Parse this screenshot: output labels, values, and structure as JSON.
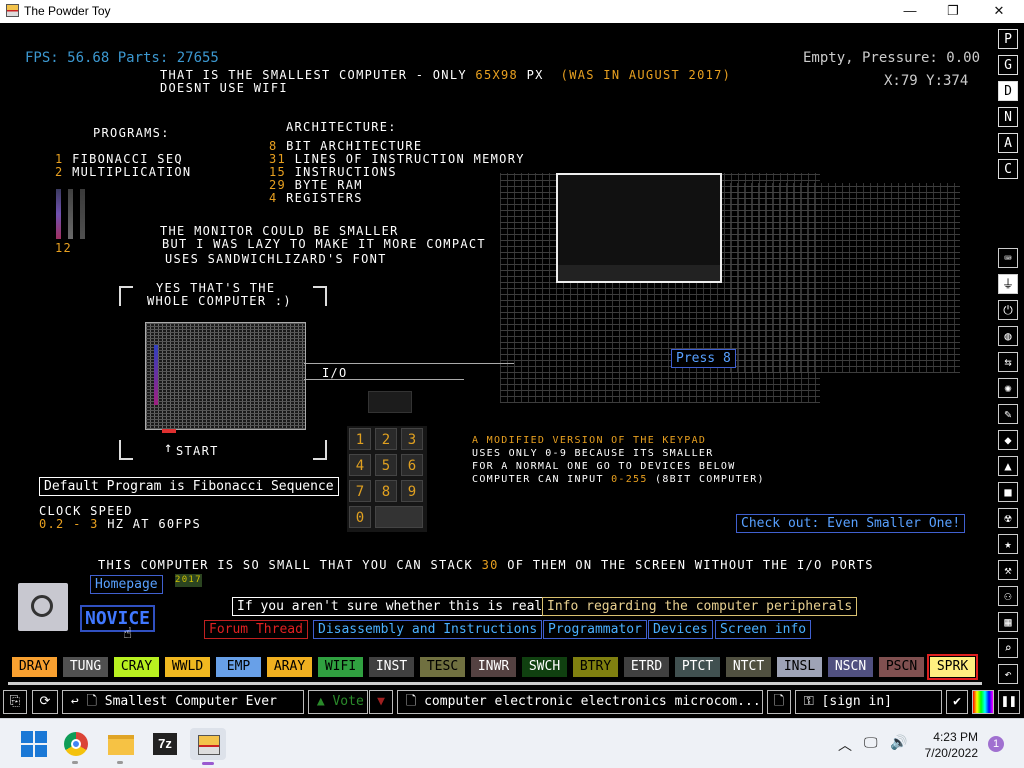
{
  "window": {
    "title": "The Powder Toy",
    "minimize": "—",
    "maximize": "❐",
    "close": "✕"
  },
  "hud": {
    "fps": "FPS: 56.68 Parts: 27655",
    "pressure": "Empty, Pressure: 0.00",
    "coords": "X:79 Y:374"
  },
  "save_text": {
    "line1a": "THAT IS THE SMALLEST COMPUTER - ONLY ",
    "line1b": "65X98",
    "line1c": " PX  ",
    "line1d": "(WAS IN AUGUST 2017)",
    "line2": "DOESNT USE WIFI",
    "programs_title": "PROGRAMS:",
    "program1_num": "1",
    "program1": "FIBONACCI SEQ",
    "program2_num": "2",
    "program2": "MULTIPLICATION",
    "bar_labels": "12",
    "arch_title": "ARCHITECTURE:",
    "arch": [
      {
        "num": "8",
        "text": "BIT ARCHITECTURE"
      },
      {
        "num": "31",
        "text": "LINES OF INSTRUCTION MEMORY"
      },
      {
        "num": "15",
        "text": "INSTRUCTIONS"
      },
      {
        "num": "29",
        "text": "BYTE RAM"
      },
      {
        "num": "4",
        "text": "REGISTERS"
      }
    ],
    "monitor1": "THE MONITOR COULD BE SMALLER",
    "monitor2": "BUT I WAS LAZY TO MAKE IT MORE COMPACT",
    "monitor3": "USES SANDWICHLIZARD'S FONT",
    "whole1": "YES THAT'S THE",
    "whole2": "WHOLE COMPUTER :)",
    "io": "I/O",
    "start": "START",
    "keypad1": "A MODIFIED VERSION OF THE KEYPAD",
    "keypad2": "USES ONLY 0-9 BECAUSE ITS SMALLER",
    "keypad3": "FOR A NORMAL ONE GO TO DEVICES BELOW",
    "keypad4a": "COMPUTER CAN INPUT ",
    "keypad4b": "0-255",
    "keypad4c": " (8BIT COMPUTER)",
    "clock1": "CLOCK SPEED",
    "clock2a": "0.2 - 3",
    "clock2b": " HZ AT 60FPS",
    "stack_a": "THIS COMPUTER IS SO SMALL THAT YOU CAN STACK ",
    "stack_b": "30",
    "stack_c": " OF THEM ON THE SCREEN WITHOUT THE I/O PORTS",
    "year": "2017"
  },
  "keypad_keys": [
    "1",
    "2",
    "3",
    "4",
    "5",
    "6",
    "7",
    "8",
    "9",
    "0"
  ],
  "labels": {
    "default_program": "Default Program is Fibonacci Sequence",
    "press8": "Press 8",
    "check_out": "Check out: Even Smaller One!",
    "homepage": "Homepage",
    "novice": "NOVICE",
    "if_unsure": "If you aren't sure whether this is real:",
    "info_peripherals": "Info regarding the computer peripherals",
    "forum_thread": "Forum Thread",
    "disassembly": "Disassembly and Instructions",
    "programmator": "Programmator",
    "devices": "Devices",
    "screen_info": "Screen info"
  },
  "right_toolbar_letters": [
    "P",
    "G",
    "D",
    "N",
    "A",
    "C"
  ],
  "right_toolbar_selected": "D",
  "right_toolbar_icons": [
    "keyboard-icon",
    "power-plug-icon",
    "power-icon",
    "sensor-icon",
    "force-icon",
    "explosive-icon",
    "pencil-icon",
    "liquid-icon",
    "powder-icon",
    "solid-icon",
    "radioactive-icon",
    "star-icon",
    "tools-icon",
    "life-icon",
    "wall-icon",
    "search-icon",
    "recent-icon"
  ],
  "elements": [
    {
      "name": "DRAY",
      "bg": "#f8a030",
      "fg": "#000"
    },
    {
      "name": "TUNG",
      "bg": "#505050",
      "fg": "#fff"
    },
    {
      "name": "CRAY",
      "bg": "#b8f020",
      "fg": "#000"
    },
    {
      "name": "WWLD",
      "bg": "#f0b820",
      "fg": "#000"
    },
    {
      "name": "EMP",
      "bg": "#68a0e8",
      "fg": "#000"
    },
    {
      "name": "ARAY",
      "bg": "#f0b020",
      "fg": "#000"
    },
    {
      "name": "WIFI",
      "bg": "#30a040",
      "fg": "#000"
    },
    {
      "name": "INST",
      "bg": "#404040",
      "fg": "#fff"
    },
    {
      "name": "TESC",
      "bg": "#707040",
      "fg": "#000"
    },
    {
      "name": "INWR",
      "bg": "#544141",
      "fg": "#fff"
    },
    {
      "name": "SWCH",
      "bg": "#104010",
      "fg": "#fff"
    },
    {
      "name": "BTRY",
      "bg": "#808010",
      "fg": "#000"
    },
    {
      "name": "ETRD",
      "bg": "#404040",
      "fg": "#fff"
    },
    {
      "name": "PTCT",
      "bg": "#405050",
      "fg": "#fff"
    },
    {
      "name": "NTCT",
      "bg": "#505040",
      "fg": "#fff"
    },
    {
      "name": "INSL",
      "bg": "#9ea3b6",
      "fg": "#000"
    },
    {
      "name": "NSCN",
      "bg": "#505080",
      "fg": "#fff"
    },
    {
      "name": "PSCN",
      "bg": "#805050",
      "fg": "#000"
    },
    {
      "name": "SPRK",
      "bg": "#fff080",
      "fg": "#000",
      "selected": true
    }
  ],
  "bottom_bar": {
    "save_name": "Smallest Computer Ever",
    "vote": "Vote",
    "tags": "computer electronic electronics microcom...",
    "sign_in": "[sign in]"
  },
  "taskbar": {
    "time": "4:23 PM",
    "date": "7/20/2022",
    "notification_count": "1",
    "apps": [
      "windows-start-icon",
      "chrome-icon",
      "file-explorer-icon",
      "7zip-icon",
      "powder-toy-icon"
    ]
  }
}
